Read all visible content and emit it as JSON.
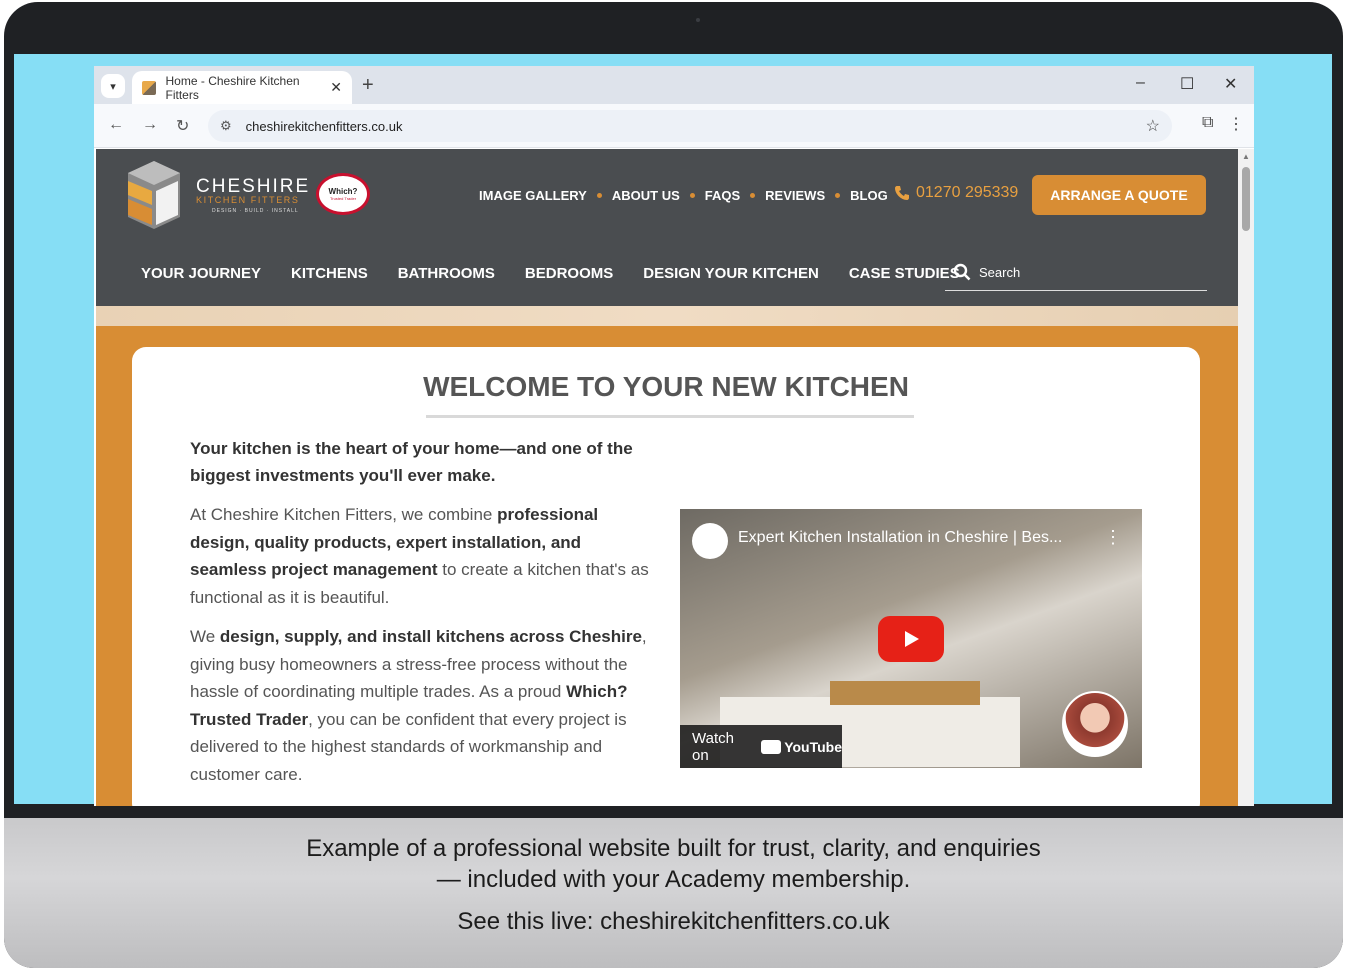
{
  "browser": {
    "tab_title": "Home - Cheshire Kitchen Fitters",
    "url": "cheshirekitchenfitters.co.uk"
  },
  "site": {
    "brand_name": "CHESHIRE",
    "brand_sub": "KITCHEN FITTERS",
    "brand_tagline": "DESIGN · BUILD · INSTALL",
    "badge_title": "Which?",
    "badge_sub": "Trusted Trader",
    "top_nav": [
      "IMAGE GALLERY",
      "ABOUT US",
      "FAQS",
      "REVIEWS",
      "BLOG"
    ],
    "phone": "01270 295339",
    "cta": "ARRANGE A QUOTE",
    "main_nav": [
      "YOUR JOURNEY",
      "KITCHENS",
      "BATHROOMS",
      "BEDROOMS",
      "DESIGN YOUR KITCHEN",
      "CASE STUDIES"
    ],
    "search_label": "Search"
  },
  "content": {
    "heading": "WELCOME TO YOUR NEW KITCHEN",
    "lead": "Your kitchen is the heart of your home—and one of the biggest investments you'll ever make.",
    "p1_a": "At Cheshire Kitchen Fitters, we combine ",
    "p1_b": "professional design, quality products, expert installation, and seamless project management",
    "p1_c": " to create a kitchen that's as functional as it is beautiful.",
    "p2_a": "We ",
    "p2_b": "design, supply, and install kitchens across Cheshire",
    "p2_c": ", giving busy homeowners a stress-free process without the hassle of coordinating multiple trades. As a proud ",
    "p2_d": "Which? Trusted Trader",
    "p2_e": ", you can be confident that every project is delivered to the highest standards of workmanship and customer care."
  },
  "video": {
    "title": "Expert Kitchen Installation in Cheshire | Bes...",
    "watch_on": "Watch on",
    "platform": "YouTube"
  },
  "caption": {
    "line1": "Example of a professional website built for trust, clarity, and enquiries",
    "line2": "— included with your Academy membership.",
    "live": "See this live: cheshirekitchenfitters.co.uk"
  }
}
